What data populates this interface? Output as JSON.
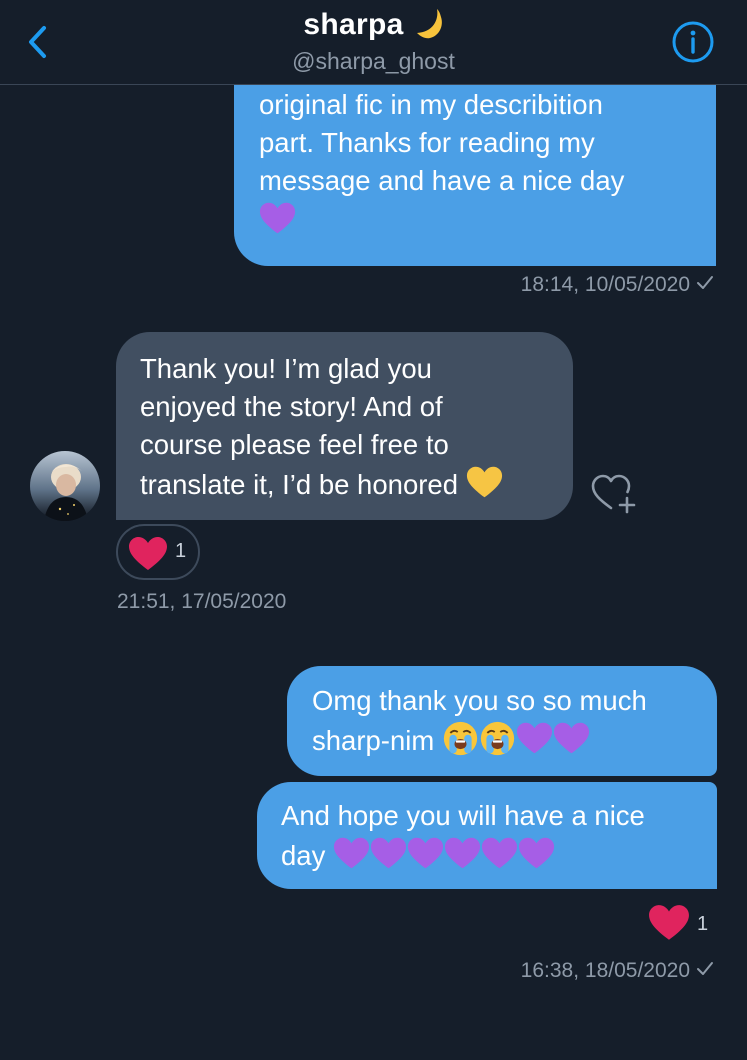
{
  "header": {
    "title": "sharpa",
    "title_emoji": "crescent-moon",
    "handle": "@sharpa_ghost",
    "back_icon": "chevron-left-icon",
    "info_icon": "info-icon"
  },
  "colors": {
    "background": "#151e2a",
    "sent_bubble": "#4b9fe6",
    "received_bubble": "#414f61",
    "accent": "#1d9bf0",
    "muted_text": "#8e9aa8",
    "heart": "#e0245e"
  },
  "messages": [
    {
      "direction": "sent",
      "lines": [
        "original fic in my describition",
        "part. Thanks for reading my",
        "message and have a nice day"
      ],
      "emojis": [
        "purple-heart"
      ],
      "timestamp": "18:14, 10/05/2020",
      "read": true
    },
    {
      "direction": "received",
      "lines": [
        "Thank you! I’m glad you",
        "enjoyed the story! And of",
        "course please feel free to",
        "translate it, I’d be honored"
      ],
      "emojis": [
        "yellow-heart"
      ],
      "reaction": {
        "emoji": "red-heart",
        "count": "1"
      },
      "timestamp": "21:51, 17/05/2020"
    },
    {
      "direction": "sent",
      "lines": [
        "Omg thank you so so much",
        "sharp-nim"
      ],
      "emojis": [
        "crying-face",
        "crying-face",
        "purple-heart",
        "purple-heart"
      ]
    },
    {
      "direction": "sent",
      "lines": [
        "And hope you will have a nice",
        "day"
      ],
      "emojis": [
        "purple-heart",
        "purple-heart",
        "purple-heart",
        "purple-heart",
        "purple-heart",
        "purple-heart"
      ],
      "reaction": {
        "emoji": "red-heart",
        "count": "1"
      },
      "timestamp": "16:38, 18/05/2020",
      "read": true
    }
  ]
}
